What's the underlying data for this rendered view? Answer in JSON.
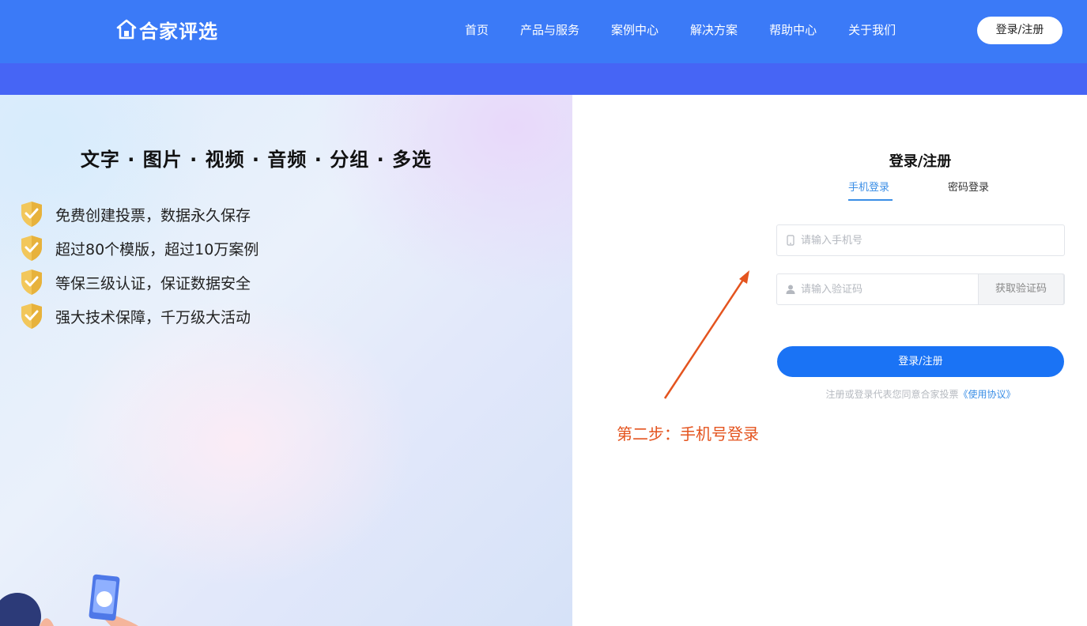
{
  "header": {
    "logo_text": "合家评选",
    "nav": [
      "首页",
      "产品与服务",
      "案例中心",
      "解决方案",
      "帮助中心",
      "关于我们"
    ],
    "login_button": "登录/注册",
    "brand_color": "#3b7af7"
  },
  "hero": {
    "title": "文字 · 图片 · 视频 · 音频 · 分组 · 多选",
    "features": [
      "免费创建投票，数据永久保存",
      "超过80个模版，超过10万案例",
      "等保三级认证，保证数据安全",
      "强大技术保障，千万级大活动"
    ],
    "feature_icon": "shield-check-icon"
  },
  "login": {
    "title": "登录/注册",
    "tabs": [
      "手机登录",
      "密码登录"
    ],
    "active_tab": "手机登录",
    "phone_placeholder": "请输入手机号",
    "code_placeholder": "请输入验证码",
    "get_code": "获取验证码",
    "submit": "登录/注册",
    "agreement_prefix": "注册或登录代表您同意合家投票",
    "agreement_link": "《使用协议》",
    "accent_color": "#1a73f5"
  },
  "annotation": {
    "text": "第二步：手机号登录",
    "color": "#e4541f"
  }
}
